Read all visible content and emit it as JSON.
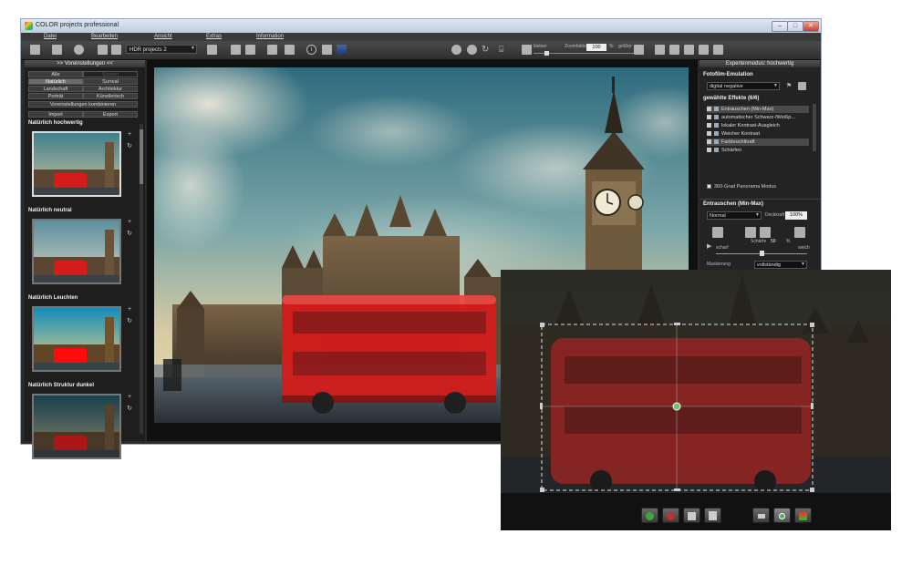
{
  "window": {
    "title": "COLOR projects professional",
    "controls": [
      "–",
      "□",
      "✕"
    ]
  },
  "menu": [
    "Datei",
    "Bearbeiten",
    "Ansicht",
    "Extras",
    "Information"
  ],
  "toolbar": {
    "preset_select": "HDR projects 2",
    "zoom_label": "Zoomfaktor",
    "zoom_value": "100",
    "zoom_unit": "%",
    "smaller_label": "kleiner",
    "larger_label": "größer"
  },
  "left_panel": {
    "header": ">> Voreinstellungen <<",
    "categories": [
      {
        "label": "Alle",
        "state": "normal"
      },
      {
        "label": "Szenen",
        "state": "dark"
      },
      {
        "label": "Natürlich",
        "state": "selected"
      },
      {
        "label": "Surreal",
        "state": "normal"
      },
      {
        "label": "Landschaft",
        "state": "normal"
      },
      {
        "label": "Architektur",
        "state": "normal"
      },
      {
        "label": "Porträt",
        "state": "normal"
      },
      {
        "label": "Künstlerisch",
        "state": "normal"
      }
    ],
    "combine_button": "Voreinstellungen kombinieren",
    "import_button": "Import",
    "export_button": "Export",
    "presets": [
      {
        "name": "Natürlich hochwertig",
        "look": "warm"
      },
      {
        "name": "Natürlich neutral",
        "look": "neutral"
      },
      {
        "name": "Natürlich Leuchten",
        "look": "vivid"
      },
      {
        "name": "Natürlich Struktur dunkel",
        "look": "dark"
      }
    ]
  },
  "right_panel": {
    "header": "Expertenmodus: hochwertig",
    "film_section": "Fotofilm-Emulation",
    "film_value": "digital negative",
    "effects_section": "gewählte Effekte (6/6)",
    "effects": [
      {
        "label": "Entrauschen (Min-Max)",
        "highlight": true
      },
      {
        "label": "automatischer Schwarz-/Weißp...",
        "highlight": false
      },
      {
        "label": "lokaler Kontrast-Ausgleich",
        "highlight": false
      },
      {
        "label": "Weicher Kontrast",
        "highlight": false
      },
      {
        "label": "Farbleuchtkraft",
        "highlight": true
      },
      {
        "label": "Schärfen",
        "highlight": false
      }
    ],
    "panorama_label": "360-Grad Panorama Modus",
    "denoise_section": "Entrauschen (Min-Max)",
    "blend_mode": "Normal",
    "opacity_label": "Deckkraft",
    "opacity_value": "100%",
    "sharp_label": "scharf",
    "sharpness_label": "Schärfe",
    "sharpness_value": "50",
    "sharpness_unit": "%",
    "soft_label": "weich",
    "sharpness_fraction": 0.5,
    "masking_label": "Maskierung",
    "masking_value": "vollständig"
  },
  "colors": {
    "window_bg": "#2a2a2a",
    "bus_red": "#d61b1b",
    "sky": "#5f8fa0",
    "panel_dark": "#1e1e1e"
  }
}
